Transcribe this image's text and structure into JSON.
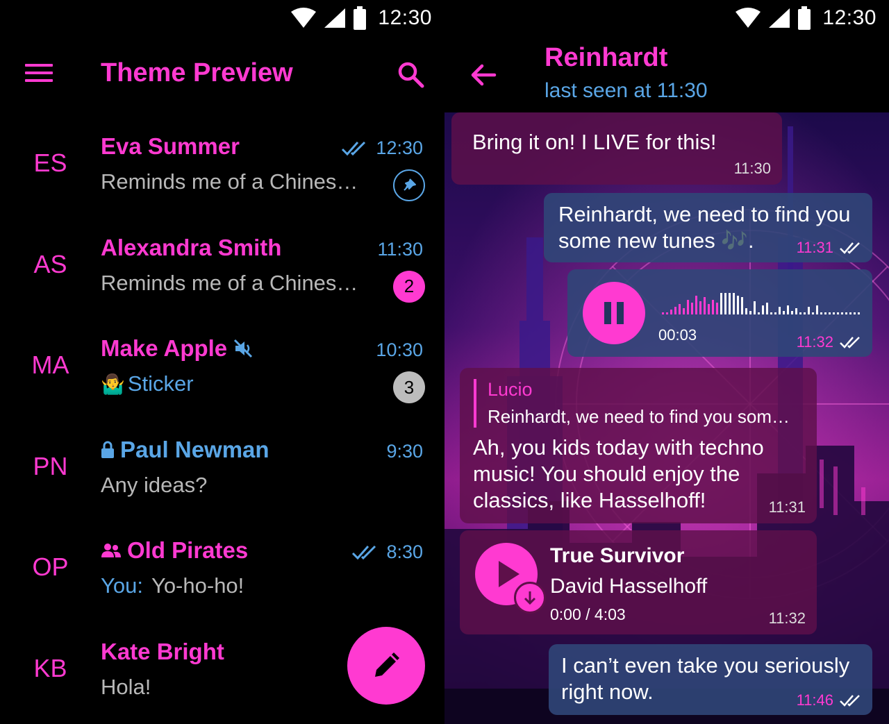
{
  "status_bar": {
    "time": "12:30"
  },
  "chat_list": {
    "title": "Theme Preview",
    "chats": [
      {
        "initials": "ES",
        "name": "Eva Summer",
        "time": "12:30",
        "preview": "Reminds me of a Chines…",
        "read": true,
        "pinned": true
      },
      {
        "initials": "AS",
        "name": "Alexandra Smith",
        "time": "11:30",
        "preview": "Reminds me of a Chines…",
        "unread": "2"
      },
      {
        "initials": "MA",
        "name": "Make Apple",
        "time": "10:30",
        "preview_emoji": "🤷‍♂️",
        "preview": "Sticker",
        "muted": true,
        "unread": "3"
      },
      {
        "initials": "PN",
        "name": "Paul Newman",
        "time": "9:30",
        "preview": "Any ideas?",
        "secret": true
      },
      {
        "initials": "OP",
        "name": "Old Pirates",
        "time": "8:30",
        "preview_sender": "You:",
        "preview": " Yo-ho-ho!",
        "group": true,
        "read": true
      },
      {
        "initials": "KB",
        "name": "Kate Bright",
        "preview": "Hola!"
      }
    ]
  },
  "chat": {
    "contact_name": "Reinhardt",
    "contact_status": "last seen at 11:30",
    "messages": [
      {
        "dir": "in",
        "text": "Bring it on! I LIVE for this!",
        "time": "11:30"
      },
      {
        "dir": "out",
        "text_line1": "Reinhardt, we need to find you",
        "text_line2": "some new tunes 🎶.",
        "time": "11:31"
      },
      {
        "dir": "out",
        "type": "voice",
        "duration": "00:03",
        "time": "11:32"
      },
      {
        "dir": "in",
        "reply_author": "Lucio",
        "reply_text": "Reinhardt, we need to find you som…",
        "text_line1": "Ah, you kids today with techno",
        "text_line2": "music! You should enjoy the",
        "text_line3": "classics, like Hasselhoff!",
        "time": "11:31"
      },
      {
        "dir": "in",
        "type": "audio",
        "title": "True Survivor",
        "performer": "David Hasselhoff",
        "progress": "0:00 / 4:03",
        "time": "11:32"
      },
      {
        "dir": "out",
        "text_line1": "I can’t even take you seriously",
        "text_line2": "right now.",
        "time": "11:46"
      }
    ]
  },
  "colors": {
    "accent": "#ff3ad1",
    "link": "#5aa6e6",
    "background": "#000000",
    "out_bubble": "#304678",
    "in_bubble": "#5e104a"
  }
}
